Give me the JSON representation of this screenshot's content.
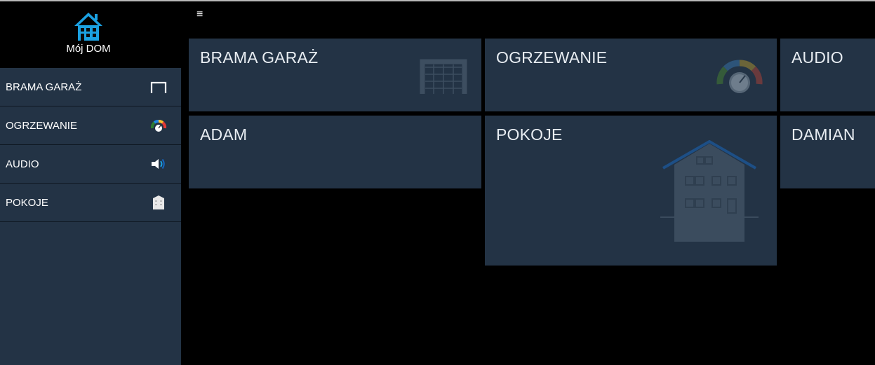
{
  "app": {
    "title": "Mój DOM",
    "colors": {
      "accent": "#1ba1e2",
      "tile_bg": "#233345",
      "sidebar_bg": "#233345",
      "page_bg": "#000000"
    }
  },
  "header": {
    "menu_icon": "hamburger-icon",
    "menu_glyph": "≡"
  },
  "sidebar": {
    "items": [
      {
        "label": "BRAMA GARAŻ",
        "icon": "gate-icon"
      },
      {
        "label": "OGRZEWANIE",
        "icon": "gauge-icon"
      },
      {
        "label": "AUDIO",
        "icon": "speaker-icon"
      },
      {
        "label": "POKOJE",
        "icon": "building-icon"
      }
    ]
  },
  "tiles": [
    {
      "title": "BRAMA GARAŻ",
      "icon": "gate-icon"
    },
    {
      "title": "OGRZEWANIE",
      "icon": "gauge-icon"
    },
    {
      "title": "AUDIO",
      "icon": ""
    },
    {
      "title": "ADAM",
      "icon": ""
    },
    {
      "title": "POKOJE",
      "icon": "building-icon"
    },
    {
      "title": "DAMIAN",
      "icon": ""
    }
  ]
}
